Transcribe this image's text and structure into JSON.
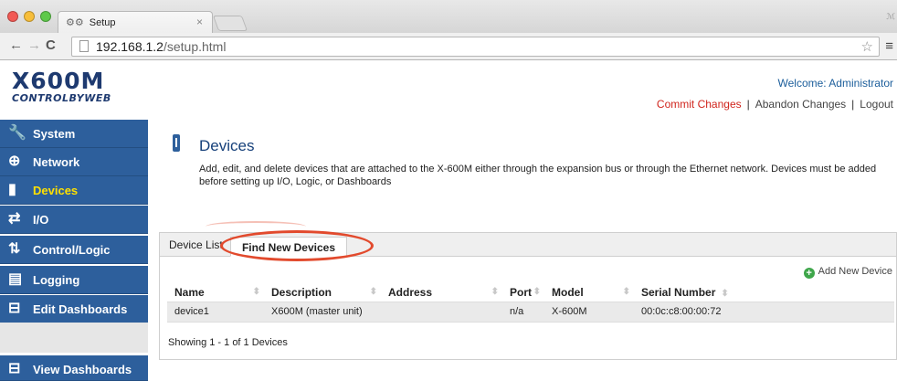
{
  "browser": {
    "tab_title": "Setup",
    "url_host": "192.168.1.2",
    "url_path": "/setup.html"
  },
  "header": {
    "logo_main": "X600M",
    "logo_sub": "CONTROLBYWEB",
    "welcome": "Welcome: Administrator",
    "commit": "Commit Changes",
    "abandon": "Abandon Changes",
    "logout": "Logout"
  },
  "sidebar": {
    "items": [
      {
        "label": "System",
        "icon": "wrench-icon"
      },
      {
        "label": "Network",
        "icon": "globe-icon"
      },
      {
        "label": "Devices",
        "icon": "device-icon"
      },
      {
        "label": "I/O",
        "icon": "arrows-icon"
      },
      {
        "label": "Control/Logic",
        "icon": "control-logic-icon"
      },
      {
        "label": "Logging",
        "icon": "logging-icon"
      },
      {
        "label": "Edit Dashboards",
        "icon": "dashboard-icon"
      },
      {
        "label": "View Dashboards",
        "icon": "dashboard-icon"
      }
    ],
    "active": "Devices"
  },
  "main": {
    "title": "Devices",
    "description": "Add, edit, and delete devices that are attached to the X-600M either through the expansion bus or through the Ethernet network. Devices must be added before setting up I/O, Logic, or Dashboards",
    "tabs": [
      "Device List",
      "Find New Devices"
    ],
    "add_device": "Add New Device",
    "columns": [
      "Name",
      "Description",
      "Address",
      "Port",
      "Model",
      "Serial Number"
    ],
    "rows": [
      [
        "device1",
        "X600M (master unit)",
        "",
        "n/a",
        "X-600M",
        "00:0c:c8:00:00:72"
      ]
    ],
    "showing": "Showing 1 - 1 of 1 Devices"
  },
  "colors": {
    "sidebar_bg": "#2d5f9c",
    "active_label": "#ffe000",
    "commit_red": "#d0251d",
    "highlight_ring": "#e24a2d"
  }
}
